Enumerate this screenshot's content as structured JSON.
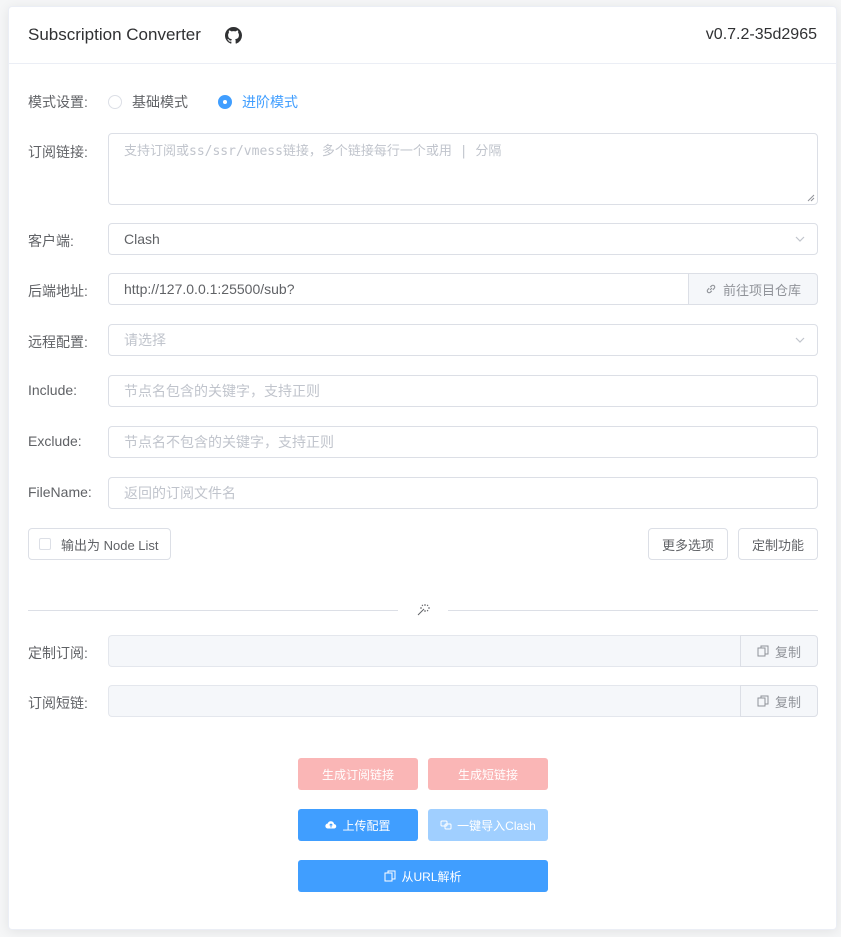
{
  "header": {
    "title": "Subscription Converter",
    "version": "v0.7.2-35d2965"
  },
  "mode": {
    "label": "模式设置:",
    "options": [
      "基础模式",
      "进阶模式"
    ],
    "selected": "进阶模式"
  },
  "subscription": {
    "label": "订阅链接:",
    "placeholder": "支持订阅或ss/ssr/vmess链接，多个链接每行一个或用 | 分隔"
  },
  "client": {
    "label": "客户端:",
    "value": "Clash"
  },
  "backend": {
    "label": "后端地址:",
    "value": "http://127.0.0.1:25500/sub?",
    "append_label": "前往项目仓库"
  },
  "remote_config": {
    "label": "远程配置:",
    "placeholder": "请选择"
  },
  "include": {
    "label": "Include:",
    "placeholder": "节点名包含的关键字，支持正则"
  },
  "exclude": {
    "label": "Exclude:",
    "placeholder": "节点名不包含的关键字，支持正则"
  },
  "filename": {
    "label": "FileName:",
    "placeholder": "返回的订阅文件名"
  },
  "options": {
    "node_list_label": "输出为 Node List",
    "more_options": "更多选项",
    "custom_features": "定制功能"
  },
  "custom_sub": {
    "label": "定制订阅:",
    "value": "",
    "copy_label": "复制"
  },
  "short_link": {
    "label": "订阅短链:",
    "value": "",
    "copy_label": "复制"
  },
  "actions": {
    "generate_sub": "生成订阅链接",
    "generate_short": "生成短链接",
    "upload_config": "上传配置",
    "import_clash": "一键导入Clash",
    "parse_url": "从URL解析"
  },
  "colors": {
    "primary": "#409eff",
    "primary_disabled": "#a0cfff",
    "danger_disabled": "#fab6b6"
  }
}
